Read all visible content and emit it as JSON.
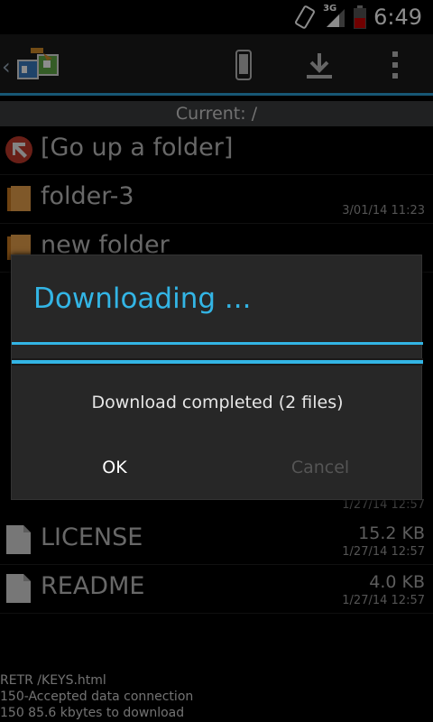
{
  "status_bar": {
    "time": "6:49",
    "network": "3G"
  },
  "current_path": "Current: /",
  "files": [
    {
      "name": "[Go up a folder]",
      "size": "",
      "date": "",
      "icon": "go-up-icon"
    },
    {
      "name": "folder-3",
      "size": "",
      "date": "3/01/14 11:23",
      "icon": "folder-icon"
    },
    {
      "name": "new folder",
      "size": "",
      "date": "",
      "icon": "folder-icon"
    },
    {
      "name": "LICENSE",
      "size": "15.2 KB",
      "date": "1/27/14 12:57",
      "icon": "file-icon"
    },
    {
      "name": "README",
      "size": "4.0 KB",
      "date": "1/27/14 12:57",
      "icon": "file-icon"
    }
  ],
  "hidden_dates": {
    "row_above_license": "1/27/14 12:57"
  },
  "log_lines": [
    "RETR /KEYS.html",
    "150-Accepted data connection",
    "150 85.6 kbytes to download"
  ],
  "dialog": {
    "title": "Downloading ...",
    "message": "Download completed (2 files)",
    "progress": 1.0,
    "ok_label": "OK",
    "cancel_label": "Cancel"
  },
  "colors": {
    "accent": "#33b5e5",
    "bar": "#2a9fd6"
  }
}
